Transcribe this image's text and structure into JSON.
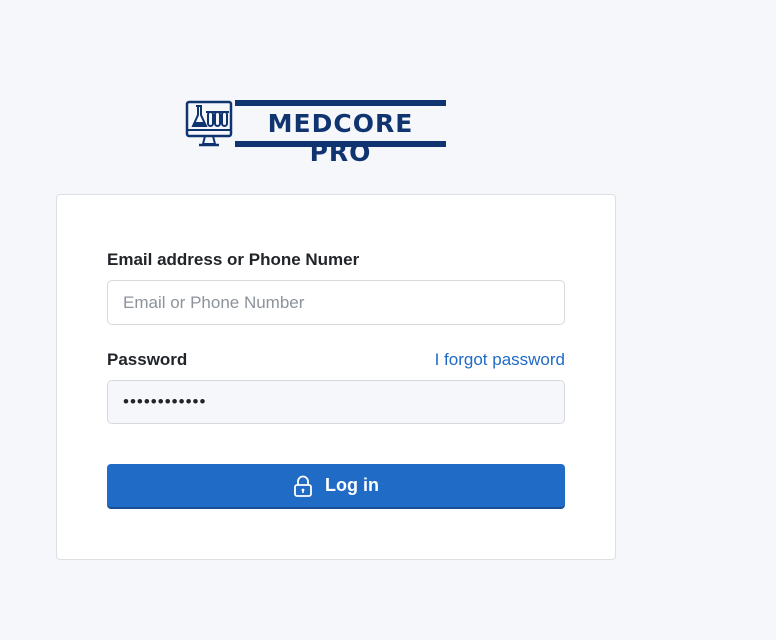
{
  "brand": {
    "name": "MEDCORE PRO",
    "logo_icon": "computer-lab-icon",
    "color": "#0f3470"
  },
  "form": {
    "email_label": "Email address or Phone Numer",
    "email_placeholder": "Email or Phone Number",
    "email_value": "",
    "password_label": "Password",
    "forgot_link": "I forgot password",
    "password_value": "••••••••••••",
    "login_label": "Log in",
    "login_icon": "lock-icon"
  },
  "colors": {
    "accent": "#1f6bc5",
    "background": "#f6f7fb",
    "card": "#ffffff"
  }
}
